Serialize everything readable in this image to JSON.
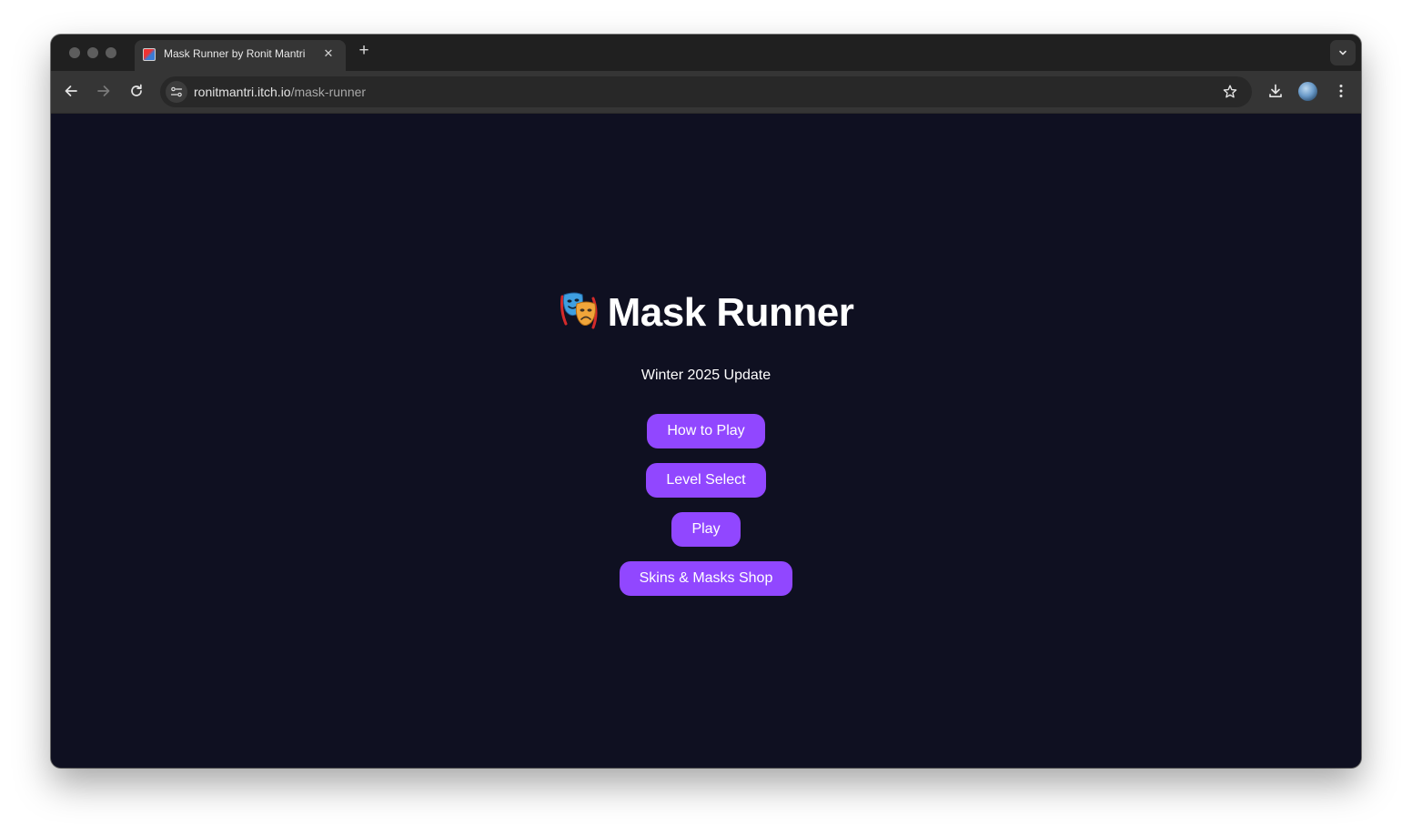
{
  "browser": {
    "tab": {
      "title": "Mask Runner by Ronit Mantri",
      "close_icon": "close-icon",
      "favicon": "game-favicon"
    },
    "new_tab_icon": "plus-icon",
    "tab_search_icon": "chevron-down-icon",
    "address_bar": {
      "domain": "ronitmantri.itch.io",
      "path": "/mask-runner"
    },
    "toolbar_icons": [
      "back-icon",
      "forward-icon",
      "reload-icon",
      "site-settings-icon",
      "bookmark-star-icon",
      "download-icon",
      "profile-avatar",
      "more-menu-icon"
    ]
  },
  "page": {
    "background": "#0f1021",
    "title_emoji": "🎭",
    "title": "Mask Runner",
    "subtitle": "Winter 2025 Update",
    "accent_color": "#9147ff",
    "buttons": {
      "how_to_play": "How to Play",
      "level_select": "Level Select",
      "play": "Play",
      "shop": "Skins & Masks Shop"
    }
  }
}
